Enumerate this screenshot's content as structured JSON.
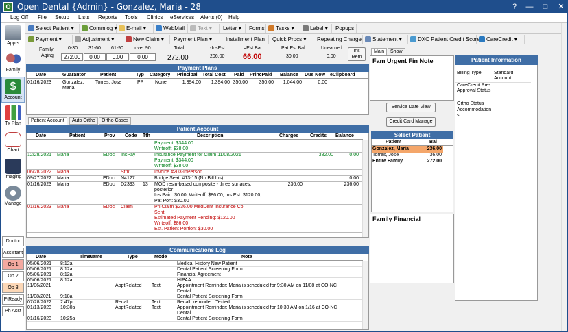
{
  "title": "Open Dental {Admin} - Gonzalez, Maria - 28",
  "window_buttons": [
    "?",
    "—",
    "□",
    "✕"
  ],
  "menu": [
    "Log Off",
    "File",
    "Setup",
    "Lists",
    "Reports",
    "Tools",
    "Clinics",
    "eServices",
    "Alerts (0)",
    "Help"
  ],
  "toolbar1": [
    "Select Patient",
    "Commlog",
    "E-mail",
    "WebMail",
    "Text",
    "Letter",
    "Forms",
    "Tasks",
    "Label",
    "Popups"
  ],
  "toolbar2": [
    "Payment",
    "Adjustment",
    "New Claim",
    "Payment Plan",
    "Installment Plan",
    "Quick Procs",
    "Repeating Charge",
    "Statement",
    "DXC Patient Credit Score",
    "CareCredit"
  ],
  "nav": [
    {
      "label": "Appts",
      "icon": "calendar-icon"
    },
    {
      "label": "Family",
      "icon": "family-icon"
    },
    {
      "label": "Account",
      "icon": "dollar-icon"
    },
    {
      "label": "Tx Plan",
      "icon": "chart-icon"
    },
    {
      "label": "Chart",
      "icon": "tooth-icon"
    },
    {
      "label": "Imaging",
      "icon": "camera-icon"
    },
    {
      "label": "Manage",
      "icon": "gear-icon"
    }
  ],
  "ops": [
    {
      "label": "Doctor",
      "color": "#ffffff"
    },
    {
      "label": "Assistant",
      "color": "#ffffff"
    },
    {
      "label": "Op 1",
      "color": "#f4a9a0"
    },
    {
      "label": "Op 2",
      "color": "#ffffff"
    },
    {
      "label": "Op 3",
      "color": "#fcd7b6"
    },
    {
      "label": "PtReady",
      "color": "#ffffff"
    },
    {
      "label": "Ph Asst",
      "color": "#ffffff"
    }
  ],
  "aging": {
    "family_label": "Family",
    "aging_label": "Aging",
    "headers": [
      "0-30",
      "31-60",
      "61-90",
      "over 90"
    ],
    "values": [
      "272.00",
      "0.00",
      "0.00",
      "0.00"
    ],
    "total_label": "Total",
    "total": "272.00",
    "insest_label": "-InsEst",
    "insest": "206.00",
    "estbal_label": "=Est Bal",
    "estbal": "66.00",
    "patest_label": "Pat Est Bal",
    "patest": "30.00",
    "unearned_label": "Unearned",
    "unearned": "0.00",
    "insrem": "Ins Rem"
  },
  "payment_plans": {
    "title": "Payment Plans",
    "headers": [
      "Date",
      "Guarantor",
      "Patient",
      "Typ",
      "Category",
      "Principal",
      "Total Cost",
      "Paid",
      "PrincPaid",
      "Balance",
      "Due Now",
      "eClipboard"
    ],
    "rows": [
      [
        "01/16/2023",
        "Gonzalez, Maria",
        "Torres, Jose",
        "PP",
        "None",
        "1,394.00",
        "1,394.00",
        "350.00",
        "350.00",
        "1,044.00",
        "0.00",
        ""
      ]
    ]
  },
  "account_tabs": [
    "Patient Account",
    "Auto Ortho",
    "Ortho Cases"
  ],
  "patient_account": {
    "title": "Patient Account",
    "headers": [
      "Date",
      "Patient",
      "Prov",
      "Code",
      "Tth",
      "Description",
      "Charges",
      "Credits",
      "Balance"
    ],
    "rows": [
      {
        "date": "",
        "patient": "",
        "prov": "",
        "code": "",
        "tth": "",
        "desc": [
          "Payment: $344.00",
          "Writeoff: $38.00"
        ],
        "charges": "",
        "credits": "",
        "balance": "",
        "color": "#00801a"
      },
      {
        "date": "12/28/2021",
        "patient": "Maria",
        "prov": "EDoc",
        "code": "InsPay",
        "tth": "",
        "desc": [
          "Insurance Payment for Claim 11/08/2021",
          "Payment: $344.00",
          "Writeoff: $38.00"
        ],
        "charges": "",
        "credits": "382.00",
        "balance": "0.00",
        "color": "#00801a"
      },
      {
        "date": "06/28/2022",
        "patient": "Maria",
        "prov": "",
        "code": "Stmt",
        "tth": "",
        "desc": [
          "Invoice #203-InPerson"
        ],
        "charges": "",
        "credits": "",
        "balance": "",
        "color": "#c00000"
      },
      {
        "date": "09/27/2022",
        "patient": "Maria",
        "prov": "EDoc",
        "code": "N4127",
        "tth": "",
        "desc": [
          "Bridge Seat: #13-15 (No Bill Ins)"
        ],
        "charges": "",
        "credits": "",
        "balance": "0.00",
        "color": "#000000"
      },
      {
        "date": "01/16/2023",
        "patient": "Maria",
        "prov": "EDoc",
        "code": "D2393",
        "tth": "13",
        "desc": [
          "MOD resin-based composite - three surfaces,",
          "posterior",
          "Ins Paid: $0.00, Writeoff: $86.00, Ins Est: $120.00,",
          "Pat Port: $30.00"
        ],
        "charges": "236.00",
        "credits": "",
        "balance": "236.00",
        "color": "#000000"
      },
      {
        "date": "01/16/2023",
        "patient": "Maria",
        "prov": "EDoc",
        "code": "Claim",
        "tth": "",
        "desc": [
          "Pri Claim $236.00 MedDent Insurance Co.",
          "Sent",
          "Estimated Payment Pending: $120.00",
          "Writeoff: $86.00",
          "Est. Patient Portion: $30.00"
        ],
        "charges": "",
        "credits": "",
        "balance": "",
        "color": "#c00000"
      }
    ]
  },
  "commlog": {
    "title": "Communications Log",
    "headers": [
      "Date",
      "Time",
      "Name",
      "Type",
      "Mode",
      "Note"
    ],
    "rows": [
      [
        "05/06/2021",
        "8:12a",
        "",
        "",
        "",
        "Medical History New Patient"
      ],
      [
        "05/06/2021",
        "8:12a",
        "",
        "",
        "",
        "Dental Patient Screening Form"
      ],
      [
        "05/06/2021",
        "8:12a",
        "",
        "",
        "",
        "Financial Agreement"
      ],
      [
        "05/06/2021",
        "8:12a",
        "",
        "",
        "",
        "HIPAA"
      ],
      [
        "11/06/2021",
        "",
        "",
        "ApptRelated",
        "Text",
        "Appointment Reminder: Maria is scheduled for 9:30 AM on 11/08 at CO-NC|Dental."
      ],
      [
        "11/08/2021",
        "9:18a",
        "",
        "",
        "",
        "Dental Patient Screening Form"
      ],
      [
        "07/28/2022",
        "2:47p",
        "",
        "Recall",
        "Text",
        "Recall  reminder.  Texted"
      ],
      [
        "01/13/2023",
        "10:30a",
        "",
        "ApptRelated",
        "Text",
        "Appointment Reminder: Maria is scheduled for 10:30 AM on 1/16 at CO-NC|Dental."
      ],
      [
        "01/16/2023",
        "10:25a",
        "",
        "",
        "",
        "Dental Patient Screening Form"
      ]
    ]
  },
  "side_tabs": [
    "Main",
    "Show"
  ],
  "fam_urgent": "Fam Urgent Fin Note",
  "service_date_btn": "Service Date View",
  "credit_card_btn": "Credit Card Manage",
  "select_patient": {
    "title": "Select Patient",
    "headers": [
      "Patient",
      "Bal"
    ],
    "rows": [
      [
        "Gonzalez, Maria",
        "236.00"
      ],
      [
        "Torres, Jose",
        "36.00"
      ],
      [
        "Entire Family",
        "272.00"
      ]
    ]
  },
  "family_financial": "Family Financial",
  "patient_info": {
    "title": "Patient Information",
    "rows": [
      [
        "Billing Type",
        "Standard Account"
      ],
      [
        "CareCredit Pre-Approval Status",
        ""
      ],
      [
        "Ortho Status",
        ""
      ],
      [
        "Accommodations",
        ""
      ]
    ]
  }
}
